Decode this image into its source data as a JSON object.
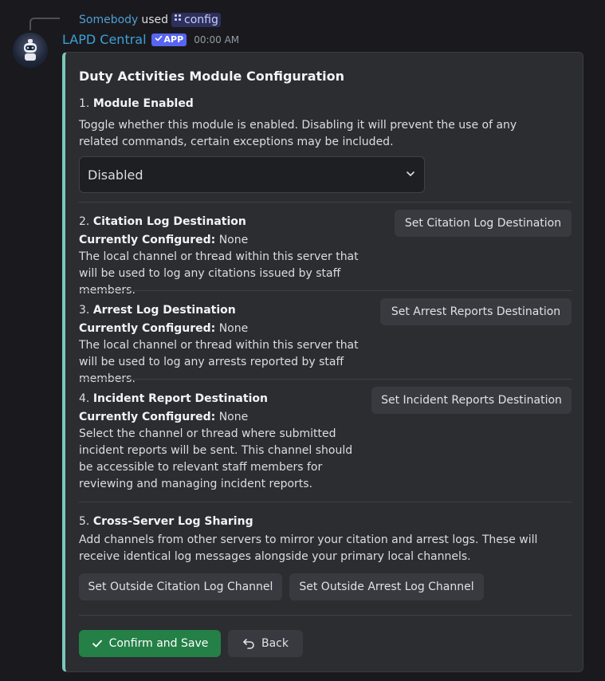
{
  "reply": {
    "user": "Somebody",
    "verb": "used",
    "command": "config"
  },
  "message": {
    "bot_name": "LAPD Central",
    "badge": "APP",
    "time": "00:00 AM"
  },
  "card": {
    "title": "Duty Activities Module Configuration",
    "sections": [
      {
        "num": "1.",
        "heading": "Module Enabled",
        "desc": "Toggle whether this module is enabled. Disabling it will prevent the use of any related commands, certain exceptions may be included.",
        "select_value": "Disabled"
      },
      {
        "num": "2.",
        "heading": "Citation Log Destination",
        "configured_label": "Currently Configured:",
        "configured_value": "None",
        "desc": "The local channel or thread within this server that will be used to log any citations issued by staff members.",
        "button": "Set Citation Log Destination"
      },
      {
        "num": "3.",
        "heading": "Arrest Log Destination",
        "configured_label": "Currently Configured:",
        "configured_value": "None",
        "desc": "The local channel or thread within this server that will be used to log any arrests reported by staff members.",
        "button": "Set Arrest Reports Destination"
      },
      {
        "num": "4.",
        "heading": "Incident Report Destination",
        "configured_label": "Currently Configured:",
        "configured_value": "None",
        "desc": "Select the channel or thread where submitted incident reports will be sent. This channel should be accessible to relevant staff members for reviewing and managing incident reports.",
        "button": "Set Incident Reports Destination"
      },
      {
        "num": "5.",
        "heading": "Cross-Server Log Sharing",
        "desc": "Add channels from other servers to mirror your citation and arrest logs. These will receive identical log messages alongside your primary local channels.",
        "button_a": "Set Outside Citation Log Channel",
        "button_b": "Set Outside Arrest Log Channel"
      }
    ],
    "confirm_label": "Confirm and Save",
    "back_label": "Back"
  },
  "colors": {
    "accent_bar": "#7cc7ba",
    "confirm": "#248046",
    "badge": "#5865f2",
    "bot_name": "#3ea0d9"
  },
  "icons": [
    "command-icon",
    "check-icon",
    "chevron-down-icon",
    "back-arrow-icon",
    "bot-avatar"
  ]
}
